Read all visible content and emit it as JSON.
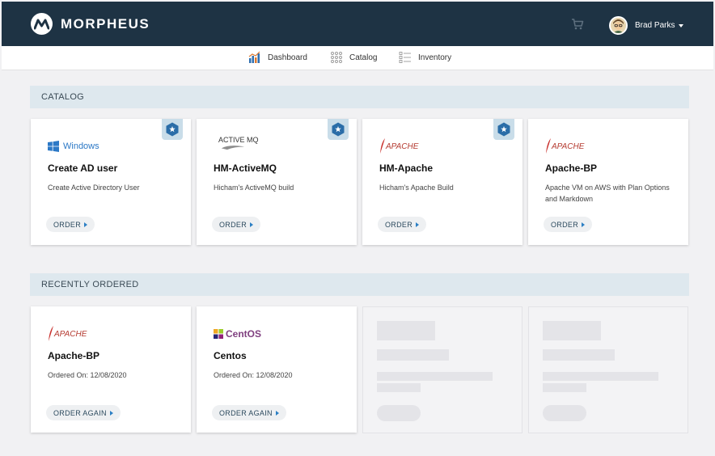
{
  "header": {
    "brand": "MORPHEUS",
    "user_name": "Brad Parks"
  },
  "nav": {
    "items": [
      {
        "label": "Dashboard",
        "icon": "bar-chart-icon"
      },
      {
        "label": "Catalog",
        "icon": "grid-icon"
      },
      {
        "label": "Inventory",
        "icon": "list-icon"
      }
    ]
  },
  "catalog": {
    "heading": "CATALOG",
    "items": [
      {
        "logo_text": "Windows",
        "title": "Create AD user",
        "description": "Create Active Directory User",
        "button": "ORDER",
        "featured": true
      },
      {
        "logo_text": "ACTIVE MQ",
        "title": "HM-ActiveMQ",
        "description": "Hicham's ActiveMQ build",
        "button": "ORDER",
        "featured": true
      },
      {
        "logo_text": "APACHE",
        "title": "HM-Apache",
        "description": "Hicham's Apache Build",
        "button": "ORDER",
        "featured": true
      },
      {
        "logo_text": "APACHE",
        "title": "Apache-BP",
        "description": "Apache VM on AWS with Plan Options and Markdown",
        "button": "ORDER",
        "featured": false
      }
    ]
  },
  "recent": {
    "heading": "RECENTLY ORDERED",
    "items": [
      {
        "logo_text": "APACHE",
        "title": "Apache-BP",
        "description": "Ordered On: 12/08/2020",
        "button": "ORDER AGAIN"
      },
      {
        "logo_text": "CentOS",
        "title": "Centos",
        "description": "Ordered On: 12/08/2020",
        "button": "ORDER AGAIN"
      }
    ]
  },
  "colors": {
    "header_bg": "#1e3344",
    "section_bg": "#dee8ee",
    "accent": "#2c7fc4",
    "badge_bg": "#c9dde9"
  }
}
